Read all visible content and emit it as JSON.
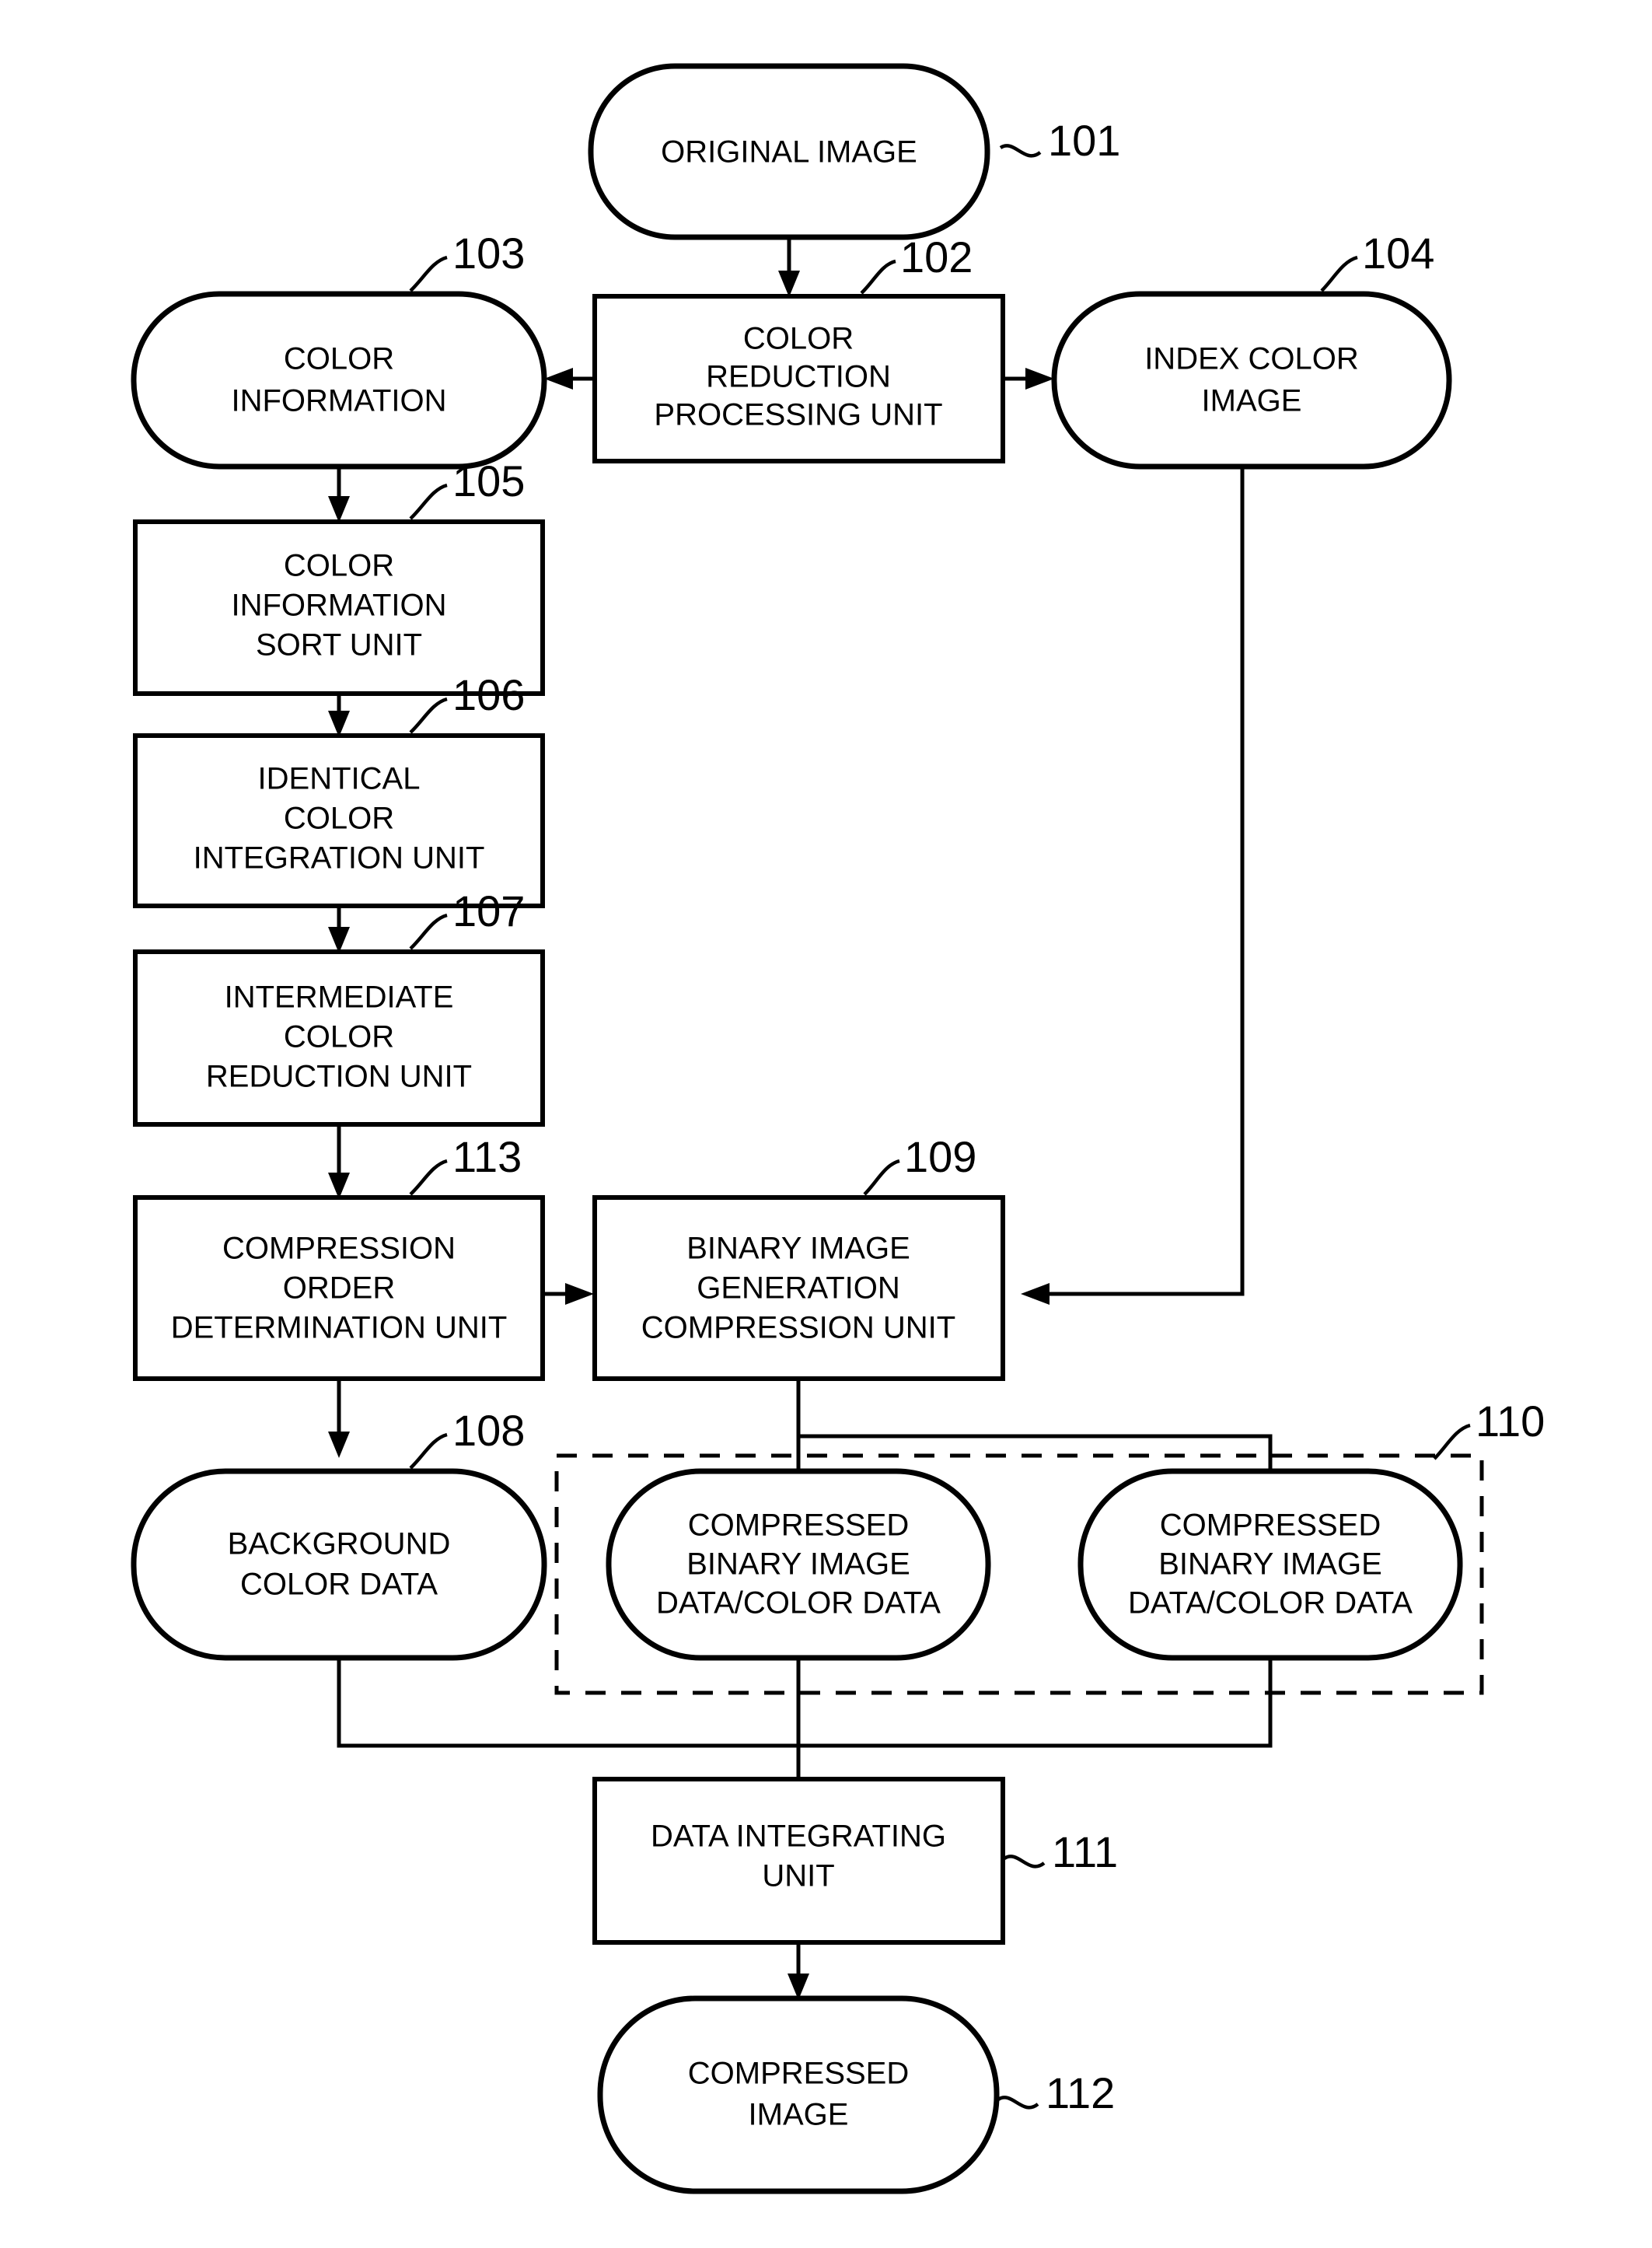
{
  "figure": {
    "type": "patent-flowchart",
    "nodes": [
      {
        "id": "n101",
        "ref": "101",
        "label_lines": [
          "ORIGINAL IMAGE"
        ],
        "shape": "rounded-terminator"
      },
      {
        "id": "n102",
        "ref": "102",
        "label_lines": [
          "COLOR",
          "REDUCTION",
          "PROCESSING UNIT"
        ],
        "shape": "rectangle"
      },
      {
        "id": "n103",
        "ref": "103",
        "label_lines": [
          "COLOR",
          "INFORMATION"
        ],
        "shape": "rounded-terminator"
      },
      {
        "id": "n104",
        "ref": "104",
        "label_lines": [
          "INDEX COLOR",
          "IMAGE"
        ],
        "shape": "rounded-terminator"
      },
      {
        "id": "n105",
        "ref": "105",
        "label_lines": [
          "COLOR",
          "INFORMATION",
          "SORT UNIT"
        ],
        "shape": "rectangle"
      },
      {
        "id": "n106",
        "ref": "106",
        "label_lines": [
          "IDENTICAL",
          "COLOR",
          "INTEGRATION UNIT"
        ],
        "shape": "rectangle"
      },
      {
        "id": "n107",
        "ref": "107",
        "label_lines": [
          "INTERMEDIATE",
          "COLOR",
          "REDUCTION UNIT"
        ],
        "shape": "rectangle"
      },
      {
        "id": "n113",
        "ref": "113",
        "label_lines": [
          "COMPRESSION",
          "ORDER",
          "DETERMINATION UNIT"
        ],
        "shape": "rectangle"
      },
      {
        "id": "n109",
        "ref": "109",
        "label_lines": [
          "BINARY IMAGE",
          "GENERATION",
          "COMPRESSION UNIT"
        ],
        "shape": "rectangle"
      },
      {
        "id": "n108",
        "ref": "108",
        "label_lines": [
          "BACKGROUND",
          "COLOR DATA"
        ],
        "shape": "rounded-terminator"
      },
      {
        "id": "n110a",
        "ref": "110",
        "label_lines": [
          "COMPRESSED",
          "BINARY IMAGE",
          "DATA/COLOR DATA"
        ],
        "shape": "rounded-terminator"
      },
      {
        "id": "n110b",
        "ref": "110",
        "label_lines": [
          "COMPRESSED",
          "BINARY IMAGE",
          "DATA/COLOR DATA"
        ],
        "shape": "rounded-terminator"
      },
      {
        "id": "n111",
        "ref": "111",
        "label_lines": [
          "DATA INTEGRATING",
          "UNIT"
        ],
        "shape": "rectangle"
      },
      {
        "id": "n112",
        "ref": "112",
        "label_lines": [
          "COMPRESSED",
          "IMAGE"
        ],
        "shape": "rounded-terminator"
      }
    ],
    "group": {
      "ref": "110",
      "style": "dashed-rectangle",
      "members": [
        "n110a",
        "n110b"
      ]
    },
    "reference_numerals": [
      "101",
      "102",
      "103",
      "104",
      "105",
      "106",
      "107",
      "108",
      "109",
      "110",
      "111",
      "112",
      "113"
    ],
    "edges": [
      {
        "from": "n101",
        "to": "n102",
        "arrow": true
      },
      {
        "from": "n102",
        "to": "n103",
        "arrow": true
      },
      {
        "from": "n102",
        "to": "n104",
        "arrow": true
      },
      {
        "from": "n103",
        "to": "n105",
        "arrow": true
      },
      {
        "from": "n105",
        "to": "n106",
        "arrow": true
      },
      {
        "from": "n106",
        "to": "n107",
        "arrow": true
      },
      {
        "from": "n107",
        "to": "n113",
        "arrow": true
      },
      {
        "from": "n113",
        "to": "n109",
        "arrow": true
      },
      {
        "from": "n104",
        "to": "n109",
        "arrow": true
      },
      {
        "from": "n113",
        "to": "n108",
        "arrow": true
      },
      {
        "from": "n109",
        "to": "n110a",
        "arrow": true
      },
      {
        "from": "n109",
        "to": "n110b",
        "arrow": true
      },
      {
        "from": "n108",
        "to": "n111",
        "arrow": false
      },
      {
        "from": "n110a",
        "to": "n111",
        "arrow": true
      },
      {
        "from": "n110b",
        "to": "n111",
        "arrow": false
      },
      {
        "from": "n111",
        "to": "n112",
        "arrow": true
      }
    ],
    "colors": {
      "stroke": "#000000",
      "fill": "#ffffff",
      "background": "#ffffff"
    }
  }
}
